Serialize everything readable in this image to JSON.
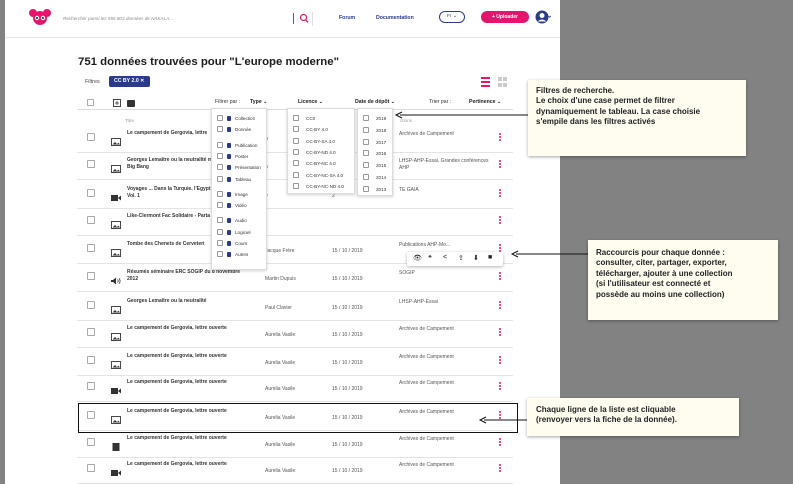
{
  "header": {
    "search_placeholder": "Rechercher parmi les 555 803 données de NAKALA...",
    "forum": "Forum",
    "documentation": "Documentation",
    "lang": "Fr ⌄",
    "upload": "+ Uploader"
  },
  "results_title": "751 données trouvées pour \"L'europe moderne\"",
  "filters": {
    "label": "Filtres",
    "active_chip": "CC BY 2.0 ✕"
  },
  "table_header": {
    "filter_by": "Filtrer par :",
    "type": "Type ⌄",
    "licence": "Licence ⌄",
    "date": "Date de dépôt ⌄",
    "sort_by": "Trier par :",
    "pertinence": "Pertinence ⌄",
    "col_title": "Titre",
    "col_collections": "ctions"
  },
  "type_options": [
    "Collection",
    "Donnée",
    "Publication",
    "Poster",
    "Présentation",
    "Tableau",
    "Image",
    "Vidéo",
    "Audio",
    "Logiciel",
    "Cours",
    "Autres"
  ],
  "licence_options": [
    "CC0",
    "CC-BY 4.0",
    "CC-BY-SA 4.0",
    "CC-BY-ND 4.0",
    "CC-BY-NC 4.0",
    "CC-BY-NC-SA 4.0",
    "CC-BY-NC-ND 4.0"
  ],
  "date_options": [
    "2019",
    "2018",
    "2017",
    "2016",
    "2015",
    "2014",
    "2013"
  ],
  "rows": [
    {
      "icon": "image-icon",
      "title": "Le campement de Gergovia, lettre",
      "author": "V",
      "date": "2",
      "collection": "Archives de Campement"
    },
    {
      "icon": "image-icon",
      "title": "Georges Lemaître ou la neutralité métaphysique du Big Bang",
      "author": "n",
      "date": "2",
      "collection": "LHSP-AHP-Essai, Grandes conférences AHP"
    },
    {
      "icon": "video-icon",
      "title": "Voyages ... Dans la Turquie, l'Egypt Palestine [...] - Vol. 1",
      "author": "fr",
      "date": "2",
      "collection": "TE GAIA"
    },
    {
      "icon": "image-icon",
      "title": "Like-Clermont Fac Solidaire - Parta",
      "author": "",
      "date": "",
      "collection": ""
    },
    {
      "icon": "image-icon",
      "title": "Tombe des Chenets de Cerveteri",
      "author": "Jacque Frère",
      "date": "15 / 10 / 2019",
      "collection": "Publications AHP-Mo..."
    },
    {
      "icon": "audio-icon",
      "title": "Résumés séminaire ERC SOGIP du 8 novembre 2012",
      "author": "Martin Dupuis",
      "date": "15 / 10 / 2019",
      "collection": "SOGIP"
    },
    {
      "icon": "image-icon",
      "title": "Georges Lemaître ou la neutralité",
      "author": "Paul Clavier",
      "date": "15 / 10 / 2019",
      "collection": "LHSP-AHP-Essai"
    },
    {
      "icon": "image-icon",
      "title": "Le campement de Gergovia, lettre ouverte",
      "author": "Aurelia Vasile",
      "date": "15 / 10 / 2019",
      "collection": "Archives de Campement"
    },
    {
      "icon": "image-icon",
      "title": "Le campement de Gergovia, lettre ouverte",
      "author": "Aurelia Vasile",
      "date": "15 / 10 / 2019",
      "collection": "Archives de Campement"
    },
    {
      "icon": "video-icon",
      "title": "Le campement de Gergovia, lettre ouverte",
      "author": "Aurelia Vasile",
      "date": "15 / 10 / 2019",
      "collection": "Archives de Campement"
    },
    {
      "icon": "image-icon",
      "title": "Le campement de Gergovia, lettre ouverte",
      "author": "Aurelia Vasile",
      "date": "15 / 10 / 2019",
      "collection": "Archives de Campement"
    },
    {
      "icon": "document-icon",
      "title": "Le campement de Gergovia, lettre ouverte",
      "author": "Aurelia Vasile",
      "date": "15 / 10 / 2019",
      "collection": "Archives de Campement"
    },
    {
      "icon": "video-icon",
      "title": "Le campement de Gergovia, lettre ouverte",
      "author": "Aurelia Vasile",
      "date": "15 / 10 / 2019",
      "collection": "Archives de Campement"
    }
  ],
  "share_actions": [
    "view-icon",
    "quote-icon",
    "share-icon",
    "export-icon",
    "download-icon",
    "collection-add-icon"
  ],
  "callouts": {
    "filters": [
      "Filtres de recherche.",
      "Le choix d'une case permet de filtrer",
      "dynamiquement le tableau. La case choisie",
      "s'empile dans les filtres activés"
    ],
    "shortcuts": [
      "Raccourcis pour chaque donnée  :",
      "consulter, citer, partager, exporter,",
      "télécharger, ajouter à une collection",
      "(si l'utilisateur est connecté et",
      "possède au moins une collection)"
    ],
    "rows": [
      "Chaque ligne de la liste est cliquable",
      "(renvoyer vers la fiche de la donnée)."
    ]
  },
  "colors": {
    "brand": "#e3156f",
    "primary": "#2b3a8c",
    "background": "#828282",
    "callout": "#fffdf0"
  }
}
